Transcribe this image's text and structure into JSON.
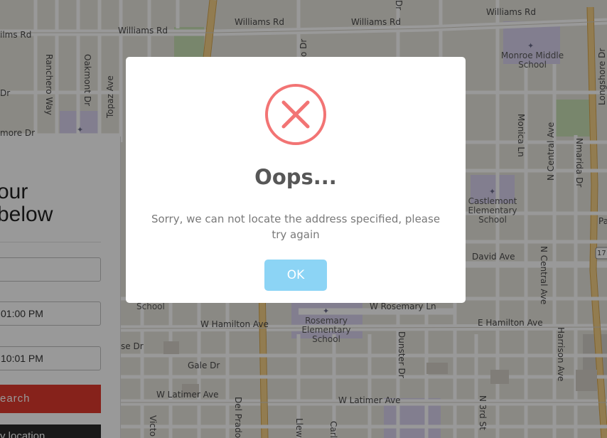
{
  "map": {
    "streets": {
      "williams_rd_1": "Williams Rd",
      "williams_rd_2": "Williams Rd",
      "williams_rd_3": "Williams Rd",
      "williams_rd_4": "Williams Rd",
      "williams_rd_5": "ilms Rd",
      "ranchero_way": "Ranchero Way",
      "oakmont_dr": "Oakmont Dr",
      "topaz_ave": "Topaz Ave",
      "monica_ln": "Monica Ln",
      "n_central_ave_top": "N Central Ave",
      "n_central_ave_bottom": "N Central Ave",
      "nmarida_dr": "Nmarida Dr",
      "longshore_dr": "Longshore Dr",
      "david_ave": "David Ave",
      "w_rosemary_ln": "W Rosemary Ln",
      "w_hamilton_ave": "W Hamilton Ave",
      "e_hamilton_ave": "E Hamilton Ave",
      "gale_dr": "Gale Dr",
      "w_latimer_ave_1": "W Latimer Ave",
      "w_latimer_ave_2": "W Latimer Ave",
      "dunster_dr": "Dunster Dr",
      "harrison_ave": "Harrison Ave",
      "n_3rd_st": "N 3rd St",
      "del_prado": "Del Prado",
      "victo": "Victo",
      "llew": "Llew",
      "carl": "Carl",
      "left_dr": "Dr",
      "left_more_dr": "more Dr",
      "left_se_dr": "se Dr",
      "right_pa": "Pa",
      "route_17": "17",
      "dr_top": "Dr",
      "o_dr": "o Dr"
    },
    "pois": {
      "monroe": "Monroe Middle\nSchool",
      "castlemont": "Castlemont\nElementary\nSchool",
      "rosemary": "Rosemary\nElementary\nSchool",
      "school_left": "School"
    }
  },
  "panel": {
    "heading_line1": "our",
    "heading_line2": "below",
    "field_location": "",
    "field_start": "01:00 PM",
    "field_end": "10:01 PM",
    "search_label": "earch",
    "location_label": "y location"
  },
  "modal": {
    "icon": "error-x-icon",
    "title": "Oops...",
    "message": "Sorry, we can not locate the address specified, please try again",
    "ok_label": "OK"
  },
  "colors": {
    "error_red": "#f27474",
    "ok_button": "#8cd4f5",
    "search_button": "#e03a2e",
    "title_text": "#575757",
    "message_text": "#797979"
  }
}
